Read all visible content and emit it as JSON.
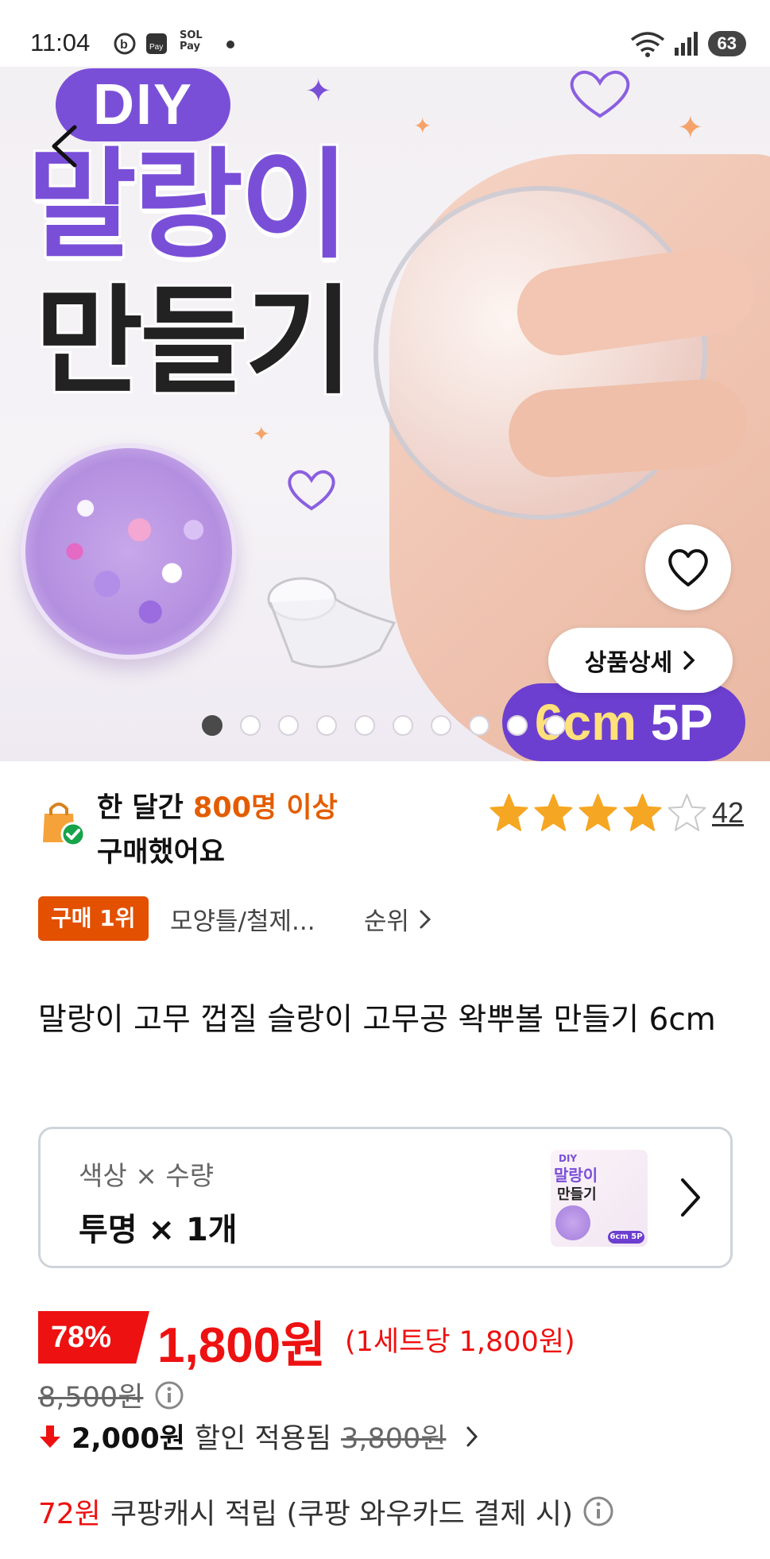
{
  "status_bar": {
    "time": "11:04",
    "battery": "63",
    "app_icons": [
      "b-icon",
      "pay-icon",
      "sol-pay-icon",
      "dot"
    ],
    "sol_label": "SOL",
    "pay_label": "Pay"
  },
  "hero": {
    "diy_label": "DIY",
    "title_line1": "말랑이",
    "title_line2": "만들기",
    "size_badge_num": "6cm",
    "size_badge_unit": "5P",
    "detail_button": "상품상세",
    "image_count": 10,
    "active_image": 0
  },
  "purchase": {
    "line1_prefix": "한 달간 ",
    "line1_highlight": "800명 이상",
    "line2": "구매했어요"
  },
  "rating": {
    "stars": 4,
    "max_stars": 5,
    "review_count": "42"
  },
  "rank": {
    "badge": "구매 1위",
    "category": "모양틀/철제...",
    "more": "순위"
  },
  "product": {
    "title": "말랑이 고무 껍질 슬랑이 고무공 왁뿌볼 만들기 6cm"
  },
  "option": {
    "label": "색상 × 수량",
    "value": "투명 × 1개",
    "thumb_diy": "DIY",
    "thumb_title_1": "말랑이",
    "thumb_title_2": "만들기",
    "thumb_badge": "6cm 5P"
  },
  "price": {
    "discount": "78%",
    "sale": "1,800원",
    "unit": "(1세트당 1,800원)",
    "original": "8,500원",
    "coupon_amount": "2,000원",
    "coupon_text": "할인 적용됨",
    "coupon_before": "3,800원"
  },
  "cashback": {
    "amount": "72원",
    "text": "쿠팡캐시 적립 (쿠팡 와우카드 결제 시)"
  },
  "colors": {
    "accent_orange": "#e35d00",
    "price_red": "#ee1111",
    "brand_purple": "#7a4fd8",
    "star": "#f5a623"
  }
}
